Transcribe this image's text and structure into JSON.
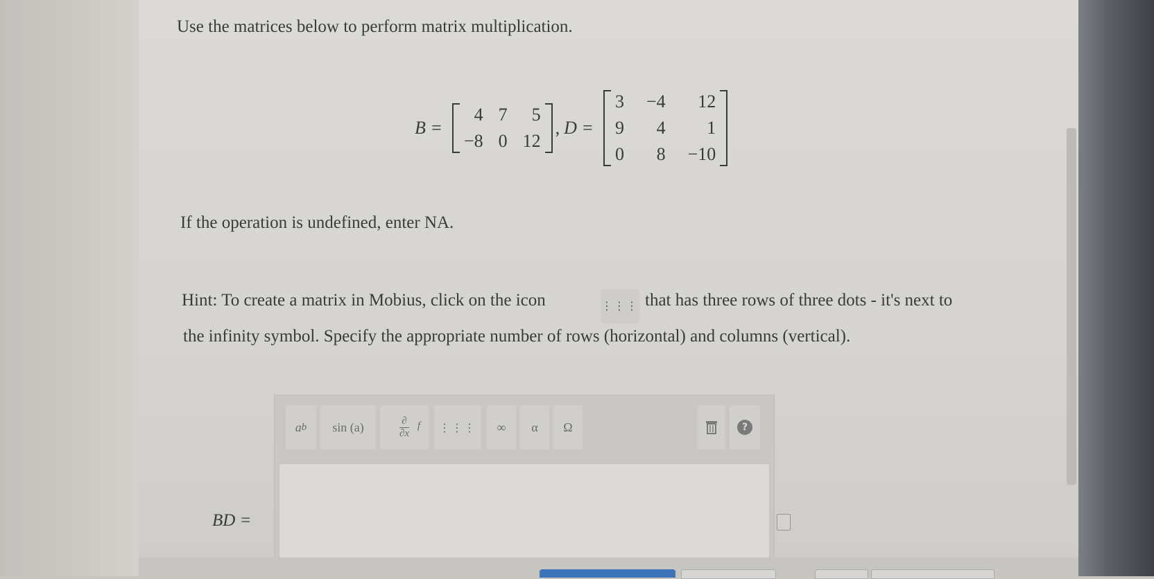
{
  "question": {
    "instruction": "Use the matrices below to perform matrix multiplication.",
    "matrix_b_label": "B =",
    "matrix_b": [
      [
        "4",
        "7",
        "5"
      ],
      [
        "−8",
        "0",
        "12"
      ]
    ],
    "separator": ",",
    "matrix_d_label": "D =",
    "matrix_d": [
      [
        "3",
        "−4",
        "12"
      ],
      [
        "9",
        "4",
        "1"
      ],
      [
        "0",
        "8",
        "−10"
      ]
    ],
    "undefined_note": "If the operation is undefined, enter NA.",
    "hint_before": "Hint: To create a matrix in Mobius, click on the icon",
    "hint_icon_glyph": "⋮⋮⋮",
    "hint_after": "that has three rows of three dots - it's next to",
    "hint_line2": "the infinity symbol. Specify the appropriate number of rows (horizontal) and columns (vertical)."
  },
  "editor": {
    "toolbar": {
      "power_base": "a",
      "power_exp": "b",
      "trig": "sin (a)",
      "deriv_top": "∂",
      "deriv_bottom": "∂x",
      "deriv_f": "f",
      "matrix_glyph": "⋮⋮⋮",
      "infinity": "∞",
      "alpha": "α",
      "omega": "Ω",
      "help": "?"
    },
    "answer_label": "BD ="
  },
  "colors": {
    "primary_button": "#3d73b8"
  }
}
